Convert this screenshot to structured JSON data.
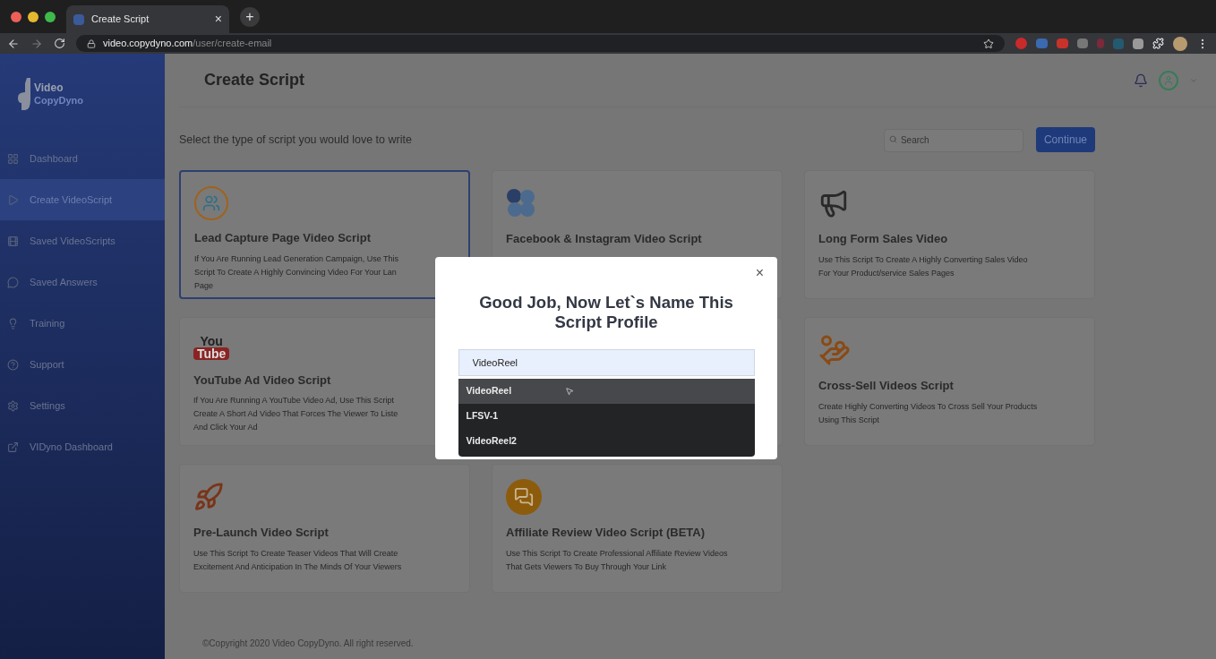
{
  "browser": {
    "tab_title": "Create Script",
    "tab_close": "×",
    "new_tab": "+",
    "url_host": "video.copydyno.com",
    "url_path": "/user/create-email"
  },
  "sidebar": {
    "logo": [
      "Video",
      "CopyDyno"
    ],
    "items": [
      {
        "label": "Dashboard",
        "selected": false
      },
      {
        "label": "Create VideoScript",
        "selected": true
      },
      {
        "label": "Saved VideoScripts",
        "selected": false
      },
      {
        "label": "Saved Answers",
        "selected": false
      },
      {
        "label": "Training",
        "selected": false
      },
      {
        "label": "Support",
        "selected": false
      },
      {
        "label": "Settings",
        "selected": false
      },
      {
        "label": "VIDyno Dashboard",
        "selected": false
      }
    ]
  },
  "header": {
    "title": "Create Script"
  },
  "toolbar": {
    "prompt": "Select the type of script you would love to write",
    "search": {
      "placeholder": "Search"
    },
    "button": "Continue"
  },
  "cards": [
    {
      "kind": "leads",
      "title": "Lead Capture Page Video Script",
      "description": [
        "If You Are Running Lead Generation Campaign, Use This",
        "Script To Create A Highly Convincing Video For Your Lan",
        "Page"
      ],
      "selected": true
    },
    {
      "kind": "social",
      "title": "Facebook & Instagram Video Script",
      "selected": false
    },
    {
      "kind": "megaphone",
      "title": "Long Form Sales Video",
      "description": [
        "Use This Script To Create A Highly Converting Sales Video",
        "For Your Product/service Sales Pages"
      ],
      "selected": false
    },
    {
      "kind": "youtube",
      "logo_text": [
        "You",
        "Tube"
      ],
      "title": "YouTube Ad Video Script",
      "description": [
        "If You Are Running A YouTube Video Ad, Use This Script",
        "Create A Short Ad Video That Forces The Viewer To Liste",
        "And Click Your Ad"
      ],
      "selected": false
    },
    {
      "kind": "covered",
      "selected": false
    },
    {
      "kind": "money",
      "title": "Cross-Sell Videos Script",
      "description": [
        "Create Highly Converting Videos To Cross Sell Your Products",
        "Using This Script"
      ],
      "selected": false
    },
    {
      "kind": "rocket",
      "title": "Pre-Launch Video Script",
      "description": [
        "Use This Script To Create Teaser Videos That Will Create",
        "Excitement And Anticipation In The Minds Of Your Viewers"
      ],
      "selected": false
    },
    {
      "kind": "chat",
      "title": "Affiliate Review Video Script (BETA)",
      "description": [
        "Use This Script To Create Professional Affiliate Review Videos",
        "That Gets Viewers To Buy Through Your Link"
      ],
      "selected": false
    }
  ],
  "footer": "©Copyright 2020 Video CopyDyno. All right reserved.",
  "modal": {
    "close": "×",
    "title": "Good Job, Now Let`s Name This Script Profile",
    "input": "VideoReel",
    "options": [
      {
        "label": "VideoReel",
        "selected": true
      },
      {
        "label": "LFSV-1",
        "selected": false
      },
      {
        "label": "VideoReel2",
        "selected": false
      }
    ]
  }
}
